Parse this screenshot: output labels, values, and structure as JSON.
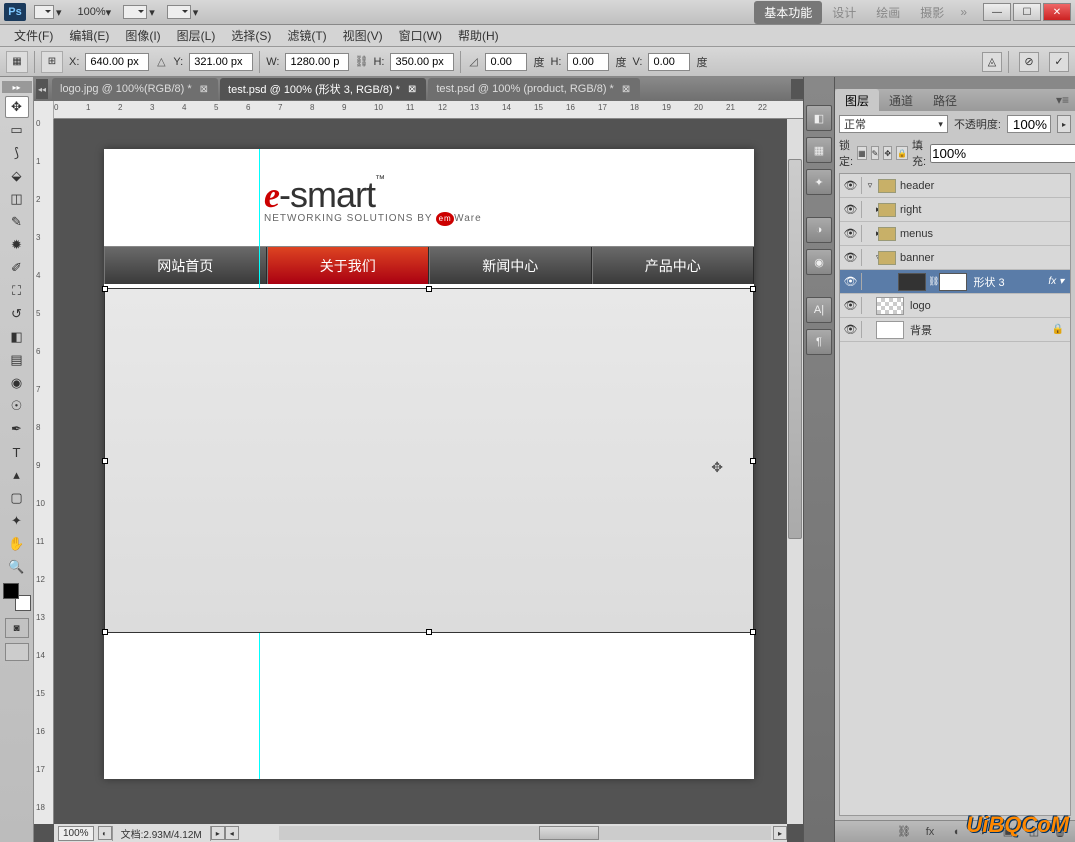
{
  "appbar": {
    "zoom": "100%",
    "modes": [
      "基本功能",
      "设计",
      "绘画",
      "摄影"
    ],
    "activeMode": 0
  },
  "menubar": [
    "文件(F)",
    "编辑(E)",
    "图像(I)",
    "图层(L)",
    "选择(S)",
    "滤镜(T)",
    "视图(V)",
    "窗口(W)",
    "帮助(H)"
  ],
  "options": {
    "x_label": "X:",
    "x": "640.00 px",
    "y_label": "Y:",
    "y": "321.00 px",
    "w_label": "W:",
    "w": "1280.00 p",
    "h_label": "H:",
    "h": "350.00 px",
    "rot_label": "",
    "rot": "0.00",
    "deg1": "度",
    "skewH_label": "H:",
    "skewH": "0.00",
    "deg2": "度",
    "skewV_label": "V:",
    "skewV": "0.00",
    "deg3": "度"
  },
  "doctabs": [
    {
      "label": "logo.jpg @ 100%(RGB/8) *"
    },
    {
      "label": "test.psd @ 100% (形状 3, RGB/8) *"
    },
    {
      "label": "test.psd @ 100% (product, RGB/8) *"
    }
  ],
  "activeDocTab": 1,
  "hruler": [
    "0",
    "1",
    "2",
    "3",
    "4",
    "5",
    "6",
    "7",
    "8",
    "9",
    "10",
    "11",
    "12",
    "13",
    "14",
    "15",
    "16",
    "17",
    "18",
    "19",
    "20",
    "21",
    "22"
  ],
  "vruler": [
    "0",
    "1",
    "2",
    "3",
    "4",
    "5",
    "6",
    "7",
    "8",
    "9",
    "10",
    "11",
    "12",
    "13",
    "14",
    "15",
    "16",
    "17",
    "18"
  ],
  "canvas": {
    "logo_prefix": "e",
    "logo_hyphen": "-",
    "logo_main": "smart",
    "logo_tm": "™",
    "tagline_pre": "NETWORKING SOLUTIONS BY ",
    "tagline_em": "em",
    "tagline_post": "Ware",
    "nav": [
      "网站首页",
      "关于我们",
      "新闻中心",
      "产品中心"
    ],
    "navActive": 1
  },
  "status": {
    "zoom": "100%",
    "docinfo": "文档:2.93M/4.12M"
  },
  "panels": {
    "tabs": [
      "图层",
      "通道",
      "路径"
    ],
    "activeTab": 0,
    "blend": "正常",
    "opacity_label": "不透明度:",
    "opacity": "100%",
    "lock_label": "锁定:",
    "fill_label": "填充:",
    "fill": "100%",
    "layers": [
      {
        "type": "group",
        "name": "header",
        "depth": 0,
        "open": true
      },
      {
        "type": "group",
        "name": "right",
        "depth": 1,
        "open": false
      },
      {
        "type": "group",
        "name": "menus",
        "depth": 1,
        "open": false
      },
      {
        "type": "group",
        "name": "banner",
        "depth": 1,
        "open": true
      },
      {
        "type": "shape",
        "name": "形状 3",
        "depth": 2,
        "sel": true,
        "fx": true
      },
      {
        "type": "raster",
        "name": "logo",
        "depth": 1
      },
      {
        "type": "bg",
        "name": "背景",
        "depth": 0,
        "locked": true
      }
    ]
  },
  "watermark": {
    "pre": "UiB",
    "mid": "Q",
    ".": ".",
    "post": "CoM"
  }
}
